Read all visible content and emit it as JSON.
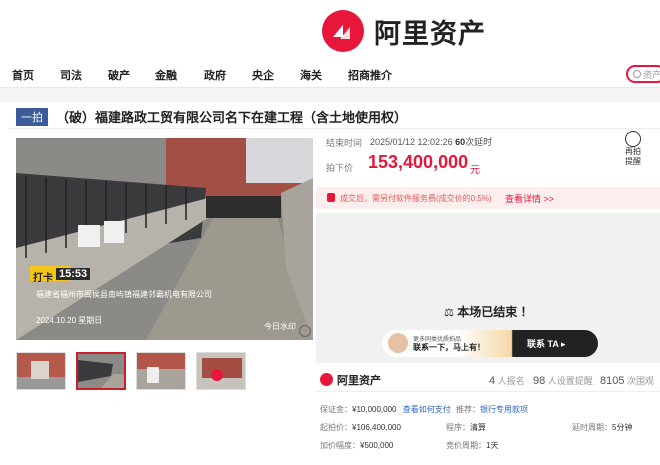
{
  "header": {
    "brand": "阿里资产"
  },
  "nav": {
    "items": [
      "首页",
      "司法",
      "破产",
      "金融",
      "政府",
      "央企",
      "海关",
      "招商推介"
    ],
    "search_placeholder": "资产"
  },
  "item": {
    "tag": "一拍",
    "title": "（破）福建路政工贸有限公司名下在建工程（含土地使用权）",
    "photo_overlay": {
      "checkin": "打卡",
      "time": "15:53",
      "location": "福建省福州市闽侯县南屿镇福建邻霸机电有限公司",
      "date": "2024.10.20 星期日",
      "watermark": "今日水印"
    }
  },
  "auction": {
    "end_label": "结束时间",
    "end_value": "2025/01/12 12:02:26",
    "delay_count": "60",
    "delay_label": "次延时",
    "reminder_line1": "再拍",
    "reminder_line2": "提醒",
    "deal_label": "拍下价",
    "deal_price": "153,400,000",
    "deal_unit": "元",
    "notice_text": "成交后，需另付软件服务费(成交价的0.5%)",
    "notice_link": "查看详情 >>",
    "ended_text": "本场已结束 ！",
    "contact_line1": "更多同类优质拍品",
    "contact_line2": "联系一下，马上有！",
    "contact_button": "联系 TA ▸"
  },
  "stats": {
    "brand": "阿里资产",
    "applicants": "4",
    "applicants_label": "人报名",
    "reminders": "98",
    "reminders_label": "人设置提醒",
    "views": "8105",
    "views_label": "次围观"
  },
  "details": {
    "deposit_label": "保证金：",
    "deposit_value": "¥10,000,000",
    "deposit_link": "查看如何支付",
    "recommend_label": "推荐：",
    "recommend_link": "银行专用款项",
    "start_label": "起拍价：",
    "start_value": "¥106,400,000",
    "increment_label": "加价幅度：",
    "increment_value": "¥500,000",
    "process_label": "程序：",
    "process_value": "清算",
    "period_label": "竞价周期：",
    "period_value": "1天",
    "delay_label": "延时周期：",
    "delay_value": "5分钟"
  },
  "colors": {
    "brand_red": "#e8163a",
    "tag_blue": "#3b5b9a",
    "link_blue": "#2a63c6"
  }
}
